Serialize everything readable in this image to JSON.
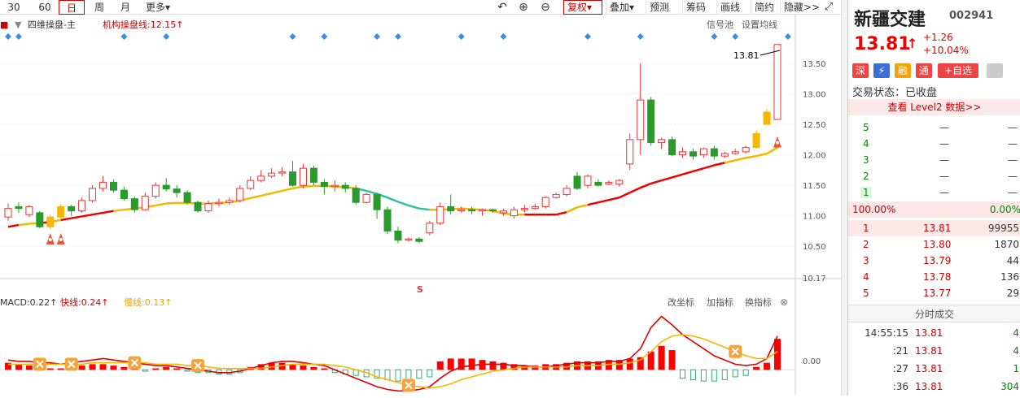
{
  "toolbar": {
    "periods": [
      "30",
      "60",
      "日",
      "周",
      "月",
      "更多"
    ],
    "selected_period": "日",
    "fuquan": "复权",
    "buttons": [
      "叠加",
      "预测",
      "筹码",
      "画线",
      "简约",
      "隐藏>>"
    ]
  },
  "main_legend": {
    "indicator_name": "四维操盘-主",
    "jigou_label": "机构操盘线:12.15↑",
    "signal_pool": "信号池",
    "set_ma": "设置均线"
  },
  "price_axis": {
    "ticks": [
      "13.50",
      "13.00",
      "12.50",
      "12.00",
      "11.50",
      "11.00",
      "10.50"
    ],
    "min_label": "10.17",
    "last_price_label": "13.81"
  },
  "macd_legend": {
    "macd": "MACD:0.22↑",
    "fast": "快线:0.24↑",
    "slow": "慢线:0.13↑",
    "zero_label": "0.00",
    "btn_coord": "改坐标",
    "btn_add": "加指标",
    "btn_swap": "换指标"
  },
  "s_marker": "S",
  "stock": {
    "name": "新疆交建",
    "code": "002941",
    "price": "13.81",
    "arrow": "↑",
    "change": "+1.26",
    "change_pct": "+10.04%",
    "tags": [
      "深",
      "⚡",
      "融",
      "通"
    ],
    "add_fav": "+自选",
    "status": "交易状态：已收盘",
    "level2": "查看 Level2 数据>>"
  },
  "order_book": {
    "asks": [
      {
        "level": "5",
        "price": "—",
        "vol": "—"
      },
      {
        "level": "4",
        "price": "—",
        "vol": "—"
      },
      {
        "level": "3",
        "price": "—",
        "vol": "—"
      },
      {
        "level": "2",
        "price": "—",
        "vol": "—"
      },
      {
        "level": "1",
        "price": "—",
        "vol": "—"
      }
    ],
    "ratio_left": "100.00%",
    "ratio_right": "0.00%",
    "bids": [
      {
        "level": "1",
        "price": "13.81",
        "vol": "99955"
      },
      {
        "level": "2",
        "price": "13.80",
        "vol": "1870"
      },
      {
        "level": "3",
        "price": "13.79",
        "vol": "44"
      },
      {
        "level": "4",
        "price": "13.78",
        "vol": "136"
      },
      {
        "level": "5",
        "price": "13.77",
        "vol": "29"
      }
    ]
  },
  "ticks_title": "分时成交",
  "ticks": [
    {
      "time": "14:55:15",
      "price": "13.81",
      "vol": "4"
    },
    {
      "time": ":21",
      "price": "13.81",
      "vol": "4"
    },
    {
      "time": ":27",
      "price": "13.81",
      "vol": "1"
    },
    {
      "time": ":36",
      "price": "13.81",
      "vol": "304"
    }
  ],
  "chart_data": {
    "type": "candlestick",
    "ylim": [
      10.17,
      13.9
    ],
    "candles": [
      [
        10.98,
        11.12,
        11.2,
        10.92
      ],
      [
        11.12,
        11.15,
        11.22,
        11.05
      ],
      [
        11.15,
        11.02,
        11.18,
        10.98
      ],
      [
        11.05,
        10.82,
        11.08,
        10.8
      ],
      [
        10.82,
        10.98,
        11.02,
        10.78
      ],
      [
        10.98,
        11.15,
        11.2,
        10.95
      ],
      [
        11.15,
        11.08,
        11.18,
        11.0
      ],
      [
        11.08,
        11.25,
        11.3,
        11.05
      ],
      [
        11.25,
        11.45,
        11.5,
        11.22
      ],
      [
        11.45,
        11.55,
        11.65,
        11.4
      ],
      [
        11.55,
        11.42,
        11.6,
        11.38
      ],
      [
        11.42,
        11.28,
        11.48,
        11.25
      ],
      [
        11.28,
        11.1,
        11.32,
        11.05
      ],
      [
        11.1,
        11.32,
        11.38,
        11.08
      ],
      [
        11.32,
        11.5,
        11.55,
        11.28
      ],
      [
        11.5,
        11.44,
        11.62,
        11.4
      ],
      [
        11.44,
        11.38,
        11.5,
        11.3
      ],
      [
        11.38,
        11.22,
        11.42,
        11.18
      ],
      [
        11.22,
        11.08,
        11.25,
        11.05
      ],
      [
        11.08,
        11.2,
        11.25,
        11.05
      ],
      [
        11.2,
        11.22,
        11.28,
        11.15
      ],
      [
        11.22,
        11.25,
        11.3,
        11.18
      ],
      [
        11.25,
        11.45,
        11.5,
        11.22
      ],
      [
        11.45,
        11.58,
        11.65,
        11.42
      ],
      [
        11.58,
        11.65,
        11.75,
        11.55
      ],
      [
        11.65,
        11.7,
        11.78,
        11.62
      ],
      [
        11.7,
        11.72,
        11.8,
        11.65
      ],
      [
        11.72,
        11.5,
        11.9,
        11.48
      ],
      [
        11.5,
        11.78,
        11.85,
        11.45
      ],
      [
        11.78,
        11.55,
        11.82,
        11.5
      ],
      [
        11.55,
        11.48,
        11.6,
        11.35
      ],
      [
        11.48,
        11.5,
        11.58,
        11.4
      ],
      [
        11.5,
        11.45,
        11.55,
        11.38
      ],
      [
        11.45,
        11.22,
        11.5,
        11.18
      ],
      [
        11.22,
        11.35,
        11.38,
        11.2
      ],
      [
        11.35,
        11.1,
        11.38,
        10.95
      ],
      [
        11.1,
        10.75,
        11.15,
        10.7
      ],
      [
        10.75,
        10.6,
        10.82,
        10.55
      ],
      [
        10.6,
        10.62,
        10.65,
        10.58
      ],
      [
        10.62,
        10.58,
        10.65,
        10.55
      ],
      [
        10.72,
        10.88,
        10.92,
        10.68
      ],
      [
        10.88,
        11.15,
        11.22,
        10.85
      ],
      [
        11.15,
        11.08,
        11.35,
        11.02
      ],
      [
        11.08,
        11.1,
        11.15,
        11.05
      ],
      [
        11.1,
        11.08,
        11.15,
        11.02
      ],
      [
        11.08,
        11.1,
        11.12,
        11.0
      ],
      [
        11.1,
        11.08,
        11.12,
        11.05
      ],
      [
        11.08,
        11.05,
        11.12,
        11.0
      ],
      [
        11.0,
        11.1,
        11.15,
        10.95
      ],
      [
        11.1,
        11.12,
        11.18,
        11.05
      ],
      [
        11.12,
        11.15,
        11.2,
        11.1
      ],
      [
        11.15,
        11.3,
        11.32,
        11.12
      ],
      [
        11.3,
        11.35,
        11.38,
        11.28
      ],
      [
        11.35,
        11.45,
        11.5,
        11.32
      ],
      [
        11.45,
        11.65,
        11.72,
        11.42
      ],
      [
        11.65,
        11.5,
        11.68,
        11.45
      ],
      [
        11.5,
        11.55,
        11.6,
        11.48
      ],
      [
        11.55,
        11.52,
        11.58,
        11.5
      ],
      [
        11.52,
        11.58,
        11.6,
        11.48
      ],
      [
        11.85,
        12.25,
        12.35,
        11.75
      ],
      [
        12.25,
        12.9,
        13.5,
        12.0
      ],
      [
        12.9,
        12.2,
        12.95,
        12.15
      ],
      [
        12.2,
        12.25,
        12.28,
        12.1
      ],
      [
        12.25,
        12.0,
        12.3,
        11.98
      ],
      [
        12.0,
        12.05,
        12.12,
        11.95
      ],
      [
        12.05,
        11.98,
        12.1,
        11.92
      ],
      [
        12.0,
        12.1,
        12.12,
        11.95
      ],
      [
        12.1,
        11.98,
        12.15,
        11.92
      ],
      [
        11.98,
        12.02,
        12.05,
        11.95
      ],
      [
        12.02,
        12.05,
        12.1,
        12.0
      ],
      [
        12.05,
        12.12,
        12.15,
        12.02
      ],
      [
        12.12,
        12.35,
        12.4,
        12.1
      ],
      [
        12.5,
        12.7,
        12.75,
        12.5
      ],
      [
        12.58,
        13.81,
        13.81,
        12.58
      ]
    ],
    "candle_colors": [
      "up",
      "down",
      "up",
      "down",
      "yellow",
      "yellow",
      "down",
      "up",
      "up",
      "up",
      "down",
      "down",
      "down",
      "up",
      "up",
      "down",
      "down",
      "down",
      "down",
      "up",
      "up",
      "up",
      "up",
      "up",
      "up",
      "up",
      "up",
      "down",
      "up",
      "down",
      "down",
      "up",
      "down",
      "down",
      "up",
      "down",
      "down",
      "down",
      "up",
      "down",
      "up",
      "up",
      "down",
      "up",
      "down",
      "up",
      "down",
      "up",
      "up",
      "up",
      "up",
      "up",
      "up",
      "up",
      "down",
      "up",
      "down",
      "up",
      "up",
      "up",
      "up",
      "down",
      "up",
      "down",
      "up",
      "down",
      "up",
      "down",
      "up",
      "up",
      "up",
      "yellow",
      "yellow",
      "up"
    ],
    "ma_line": [
      10.82,
      10.85,
      10.87,
      10.88,
      10.9,
      10.93,
      10.96,
      10.99,
      11.02,
      11.05,
      11.08,
      11.1,
      11.12,
      11.14,
      11.17,
      11.2,
      11.21,
      11.21,
      11.2,
      11.2,
      11.21,
      11.22,
      11.25,
      11.29,
      11.33,
      11.37,
      11.41,
      11.45,
      11.48,
      11.49,
      11.49,
      11.48,
      11.47,
      11.45,
      11.41,
      11.36,
      11.3,
      11.23,
      11.17,
      11.12,
      11.1,
      11.1,
      11.11,
      11.12,
      11.11,
      11.1,
      11.08,
      11.04,
      11.02,
      11.02,
      11.02,
      11.02,
      11.02,
      11.06,
      11.14,
      11.18,
      11.22,
      11.26,
      11.3,
      11.38,
      11.46,
      11.53,
      11.58,
      11.63,
      11.68,
      11.73,
      11.78,
      11.83,
      11.87,
      11.91,
      11.95,
      11.98,
      12.02,
      12.12
    ],
    "macd_hist": [
      0.05,
      0.04,
      0.03,
      0.02,
      0.01,
      0.01,
      0.02,
      0.03,
      0.04,
      0.04,
      0.03,
      0.02,
      0.01,
      -0.01,
      0.01,
      0.02,
      0.01,
      -0.01,
      -0.02,
      -0.02,
      -0.03,
      -0.03,
      -0.02,
      0.02,
      0.04,
      0.05,
      0.05,
      0.04,
      0.03,
      0.02,
      0.01,
      -0.02,
      -0.03,
      -0.04,
      -0.05,
      -0.06,
      -0.07,
      -0.08,
      -0.07,
      -0.06,
      -0.05,
      0.06,
      0.08,
      0.08,
      0.08,
      0.07,
      0.06,
      0.05,
      0.04,
      0.03,
      0.03,
      0.04,
      0.04,
      0.05,
      0.06,
      0.06,
      0.06,
      0.07,
      0.07,
      0.08,
      0.09,
      0.13,
      0.17,
      0.14,
      -0.06,
      -0.07,
      -0.08,
      -0.08,
      -0.07,
      -0.05,
      -0.04,
      0.02,
      0.05,
      0.22
    ],
    "macd_fast": [
      0.07,
      0.06,
      0.06,
      0.05,
      0.05,
      0.04,
      0.05,
      0.06,
      0.07,
      0.08,
      0.07,
      0.06,
      0.05,
      0.04,
      0.03,
      0.03,
      0.02,
      0.01,
      0.0,
      -0.01,
      -0.02,
      -0.02,
      -0.01,
      0.01,
      0.03,
      0.05,
      0.06,
      0.06,
      0.05,
      0.04,
      0.03,
      0.0,
      -0.03,
      -0.06,
      -0.09,
      -0.12,
      -0.14,
      -0.15,
      -0.15,
      -0.14,
      -0.12,
      -0.06,
      -0.01,
      0.02,
      0.03,
      0.04,
      0.04,
      0.04,
      0.03,
      0.03,
      0.02,
      0.02,
      0.03,
      0.04,
      0.05,
      0.05,
      0.05,
      0.06,
      0.06,
      0.08,
      0.15,
      0.3,
      0.38,
      0.32,
      0.25,
      0.2,
      0.15,
      0.1,
      0.07,
      0.04,
      0.03,
      0.04,
      0.08,
      0.24
    ],
    "macd_slow": [
      0.04,
      0.04,
      0.04,
      0.04,
      0.04,
      0.04,
      0.04,
      0.04,
      0.05,
      0.05,
      0.05,
      0.05,
      0.05,
      0.05,
      0.04,
      0.04,
      0.04,
      0.03,
      0.03,
      0.02,
      0.01,
      0.01,
      0.01,
      0.01,
      0.01,
      0.02,
      0.03,
      0.04,
      0.04,
      0.04,
      0.04,
      0.03,
      0.02,
      0.0,
      -0.02,
      -0.05,
      -0.07,
      -0.09,
      -0.11,
      -0.12,
      -0.13,
      -0.12,
      -0.1,
      -0.07,
      -0.05,
      -0.03,
      -0.01,
      0.0,
      0.01,
      0.02,
      0.02,
      0.02,
      0.02,
      0.02,
      0.03,
      0.03,
      0.03,
      0.04,
      0.04,
      0.05,
      0.07,
      0.13,
      0.2,
      0.24,
      0.25,
      0.24,
      0.22,
      0.19,
      0.16,
      0.13,
      0.1,
      0.08,
      0.08,
      0.13
    ],
    "macd_ylim": [
      -0.16,
      0.4
    ],
    "signal_markers_top_index": [
      0,
      1,
      11,
      15,
      27,
      30,
      35,
      37,
      43,
      47,
      55,
      60,
      67,
      69,
      74
    ],
    "buy_markers_index": [
      4,
      5,
      73
    ],
    "sell_marker_index": 39,
    "x_markers_index": [
      3,
      6,
      12,
      18,
      38,
      69
    ]
  }
}
